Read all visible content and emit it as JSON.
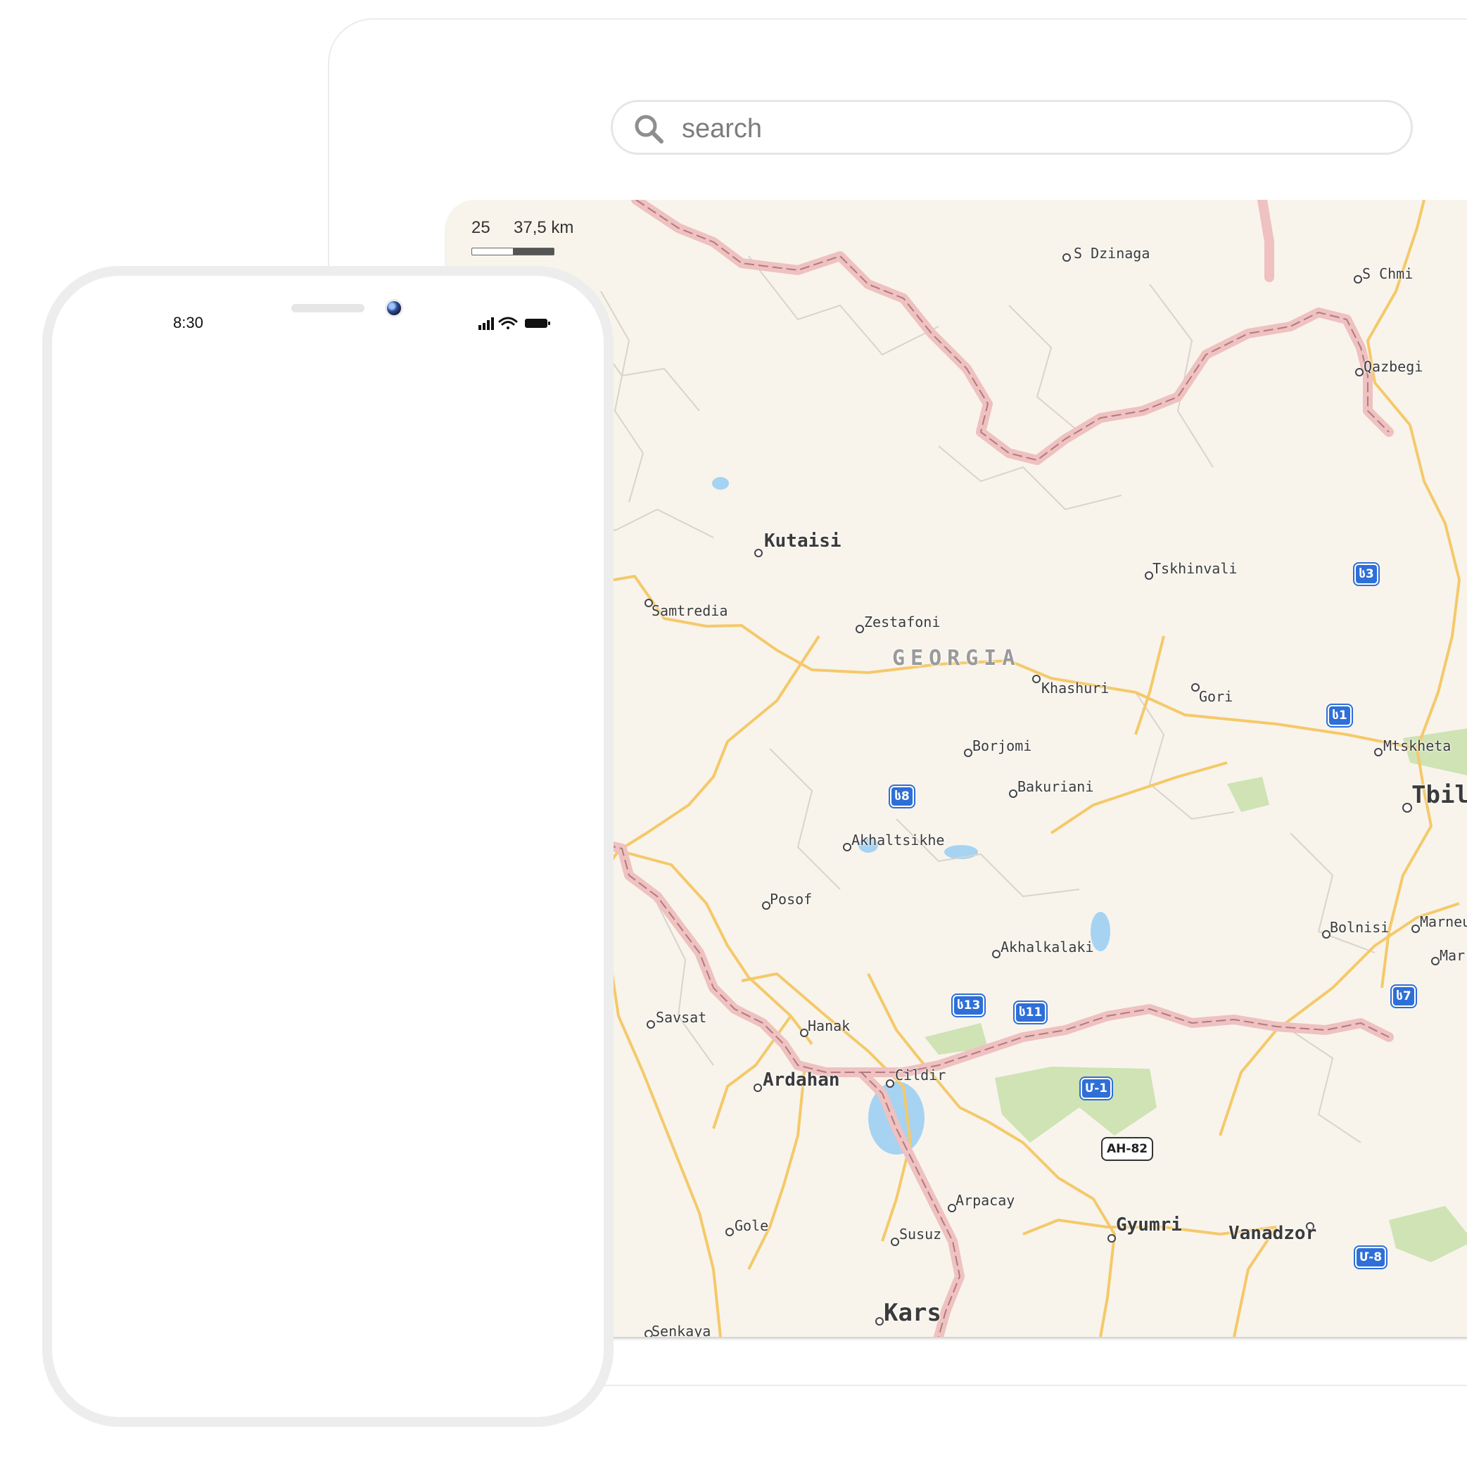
{
  "search": {
    "placeholder": "search"
  },
  "map": {
    "scale": {
      "tick_left": "25",
      "tick_right": "37,5 km"
    },
    "country_label": "GEORGIA",
    "places": {
      "s_dzinaga": "S Dzinaga",
      "s_chmi": "S Chmi",
      "qazbegi": "Qazbegi",
      "kutaisi": "Kutaisi",
      "tskhinvali": "Tskhinvali",
      "samtredia": "Samtredia",
      "zestafoni": "Zestafoni",
      "khashuri": "Khashuri",
      "gori": "Gori",
      "mtskheta": "Mtskheta",
      "tbilisi": "Tbilis",
      "borjomi": "Borjomi",
      "bakuriani": "Bakuriani",
      "akhaltsikhe": "Akhaltsikhe",
      "posof": "Posof",
      "bolnisi": "Bolnisi",
      "marneuli": "Marneu",
      "marn2": "Marr",
      "akhalkalaki": "Akhalkalaki",
      "savsat": "Savsat",
      "hanak": "Hanak",
      "ardahan": "Ardahan",
      "cildir": "Cildir",
      "arpacay": "Arpacay",
      "gole": "Gole",
      "susuz": "Susuz",
      "gyumri": "Gyumri",
      "vanadzor": "Vanadzor",
      "kars": "Kars",
      "senkaya": "Senkaya"
    },
    "shields": {
      "s3": "ს3",
      "s1": "ს1",
      "s8": "ს8",
      "s13": "ს13",
      "s11": "ს11",
      "s7": "ს7",
      "m1": "Մ-1",
      "ah82": "AH-82",
      "m8": "Մ-8"
    },
    "colors": {
      "land": "#f8f4ec",
      "road": "#f5c96a",
      "border": "#e8a9a9",
      "water": "#a6d3f2",
      "park": "#cfe3b5"
    }
  },
  "phone": {
    "time": "8:30"
  }
}
